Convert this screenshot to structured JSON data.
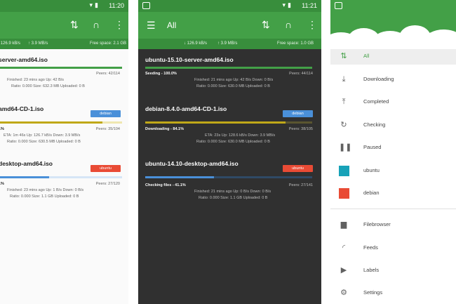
{
  "status_time_1": "11:20",
  "status_time_2": "11:21",
  "speed": {
    "down": "↓ 126.9 kB/s",
    "up": "↑ 3.9 MB/s",
    "free_label": "Free space: 2.1 GB",
    "free_label_2": "Free space: 1.0 GB"
  },
  "toolbar": {
    "title": "All"
  },
  "panel1": {
    "torrents": [
      {
        "name": "server-amd64.iso",
        "progress": 100,
        "peers": "Peers: 42/114",
        "line1": "Finished: 23 mins ago   Up: 42 B/s",
        "line2": "Ratio: 0.000   Size: 632.3 MB   Uploaded: 0 B"
      },
      {
        "name": "amd64-CD-1.iso",
        "progress": 84.1,
        "badge": "debian",
        "status": "1%",
        "peers": "Peers: 35/104",
        "line1": "ETA: 1m 46s   Up: 126.7 kB/s   Down: 3.9 MB/s",
        "line2": "Ratio: 0.000   Size: 630.5 MB   Uploaded: 0 B"
      },
      {
        "name": "desktop-amd64.iso",
        "progress": 41.1,
        "badge": "ubuntu",
        "status": "1%",
        "peers": "Peers: 27/120",
        "line1": "Finished: 23 mins ago   Up: 1 B/s   Down: 0 B/s",
        "line2": "Ratio: 0.000   Size: 1.1 GB   Uploaded: 0 B"
      }
    ]
  },
  "panel2": {
    "torrents": [
      {
        "name": "ubuntu-15.10-server-amd64.iso",
        "progress": 100,
        "status": "Seeding - 100.0%",
        "peers": "Peers: 44/114",
        "line1": "Finished: 21 mins ago   Up: 42 B/s   Down: 0 B/s",
        "line2": "Ratio: 0.000   Size: 630.0 MB   Uploaded: 0 B"
      },
      {
        "name": "debian-8.4.0-amd64-CD-1.iso",
        "progress": 84.1,
        "badge": "debian",
        "status": "Downloading - 84.1%",
        "peers": "Peers: 38/105",
        "line1": "ETA: 23s   Up: 128.6 kB/s   Down: 3.9 MB/s",
        "line2": "Ratio: 0.000   Size: 630.0 MB   Uploaded: 0 B"
      },
      {
        "name": "ubuntu-14.10-desktop-amd64.iso",
        "progress": 41.1,
        "badge": "ubuntu",
        "status": "Checking files - 41.1%",
        "peers": "Peers: 27/141",
        "line1": "Finished: 21 mins ago   Up: 0 B/s   Down: 0 B/s",
        "line2": "Ratio: 0.000   Size: 1.1 GB   Uploaded: 0 B"
      }
    ]
  },
  "drawer": {
    "filters": [
      {
        "label": "All",
        "icon": "sort-icon",
        "selected": true
      },
      {
        "label": "Downloading",
        "icon": "download-icon"
      },
      {
        "label": "Completed",
        "icon": "upload-icon"
      },
      {
        "label": "Checking",
        "icon": "refresh-icon"
      },
      {
        "label": "Paused",
        "icon": "pause-icon"
      }
    ],
    "labels": [
      {
        "label": "ubuntu",
        "color": "#17a2b8"
      },
      {
        "label": "debian",
        "color": "#e94b35"
      }
    ],
    "links": [
      {
        "label": "Filebrowser",
        "icon": "folder-icon"
      },
      {
        "label": "Feeds",
        "icon": "rss-icon"
      },
      {
        "label": "Labels",
        "icon": "label-icon"
      },
      {
        "label": "Settings",
        "icon": "gear-icon"
      }
    ]
  },
  "colors": {
    "primary": "#43a047",
    "primary_dark": "#388e3c",
    "seeding": "#43a047",
    "downloading": "#c0a818",
    "checking": "#4a90d9",
    "badge_debian": "#4a90d9",
    "badge_ubuntu": "#e94b35"
  }
}
